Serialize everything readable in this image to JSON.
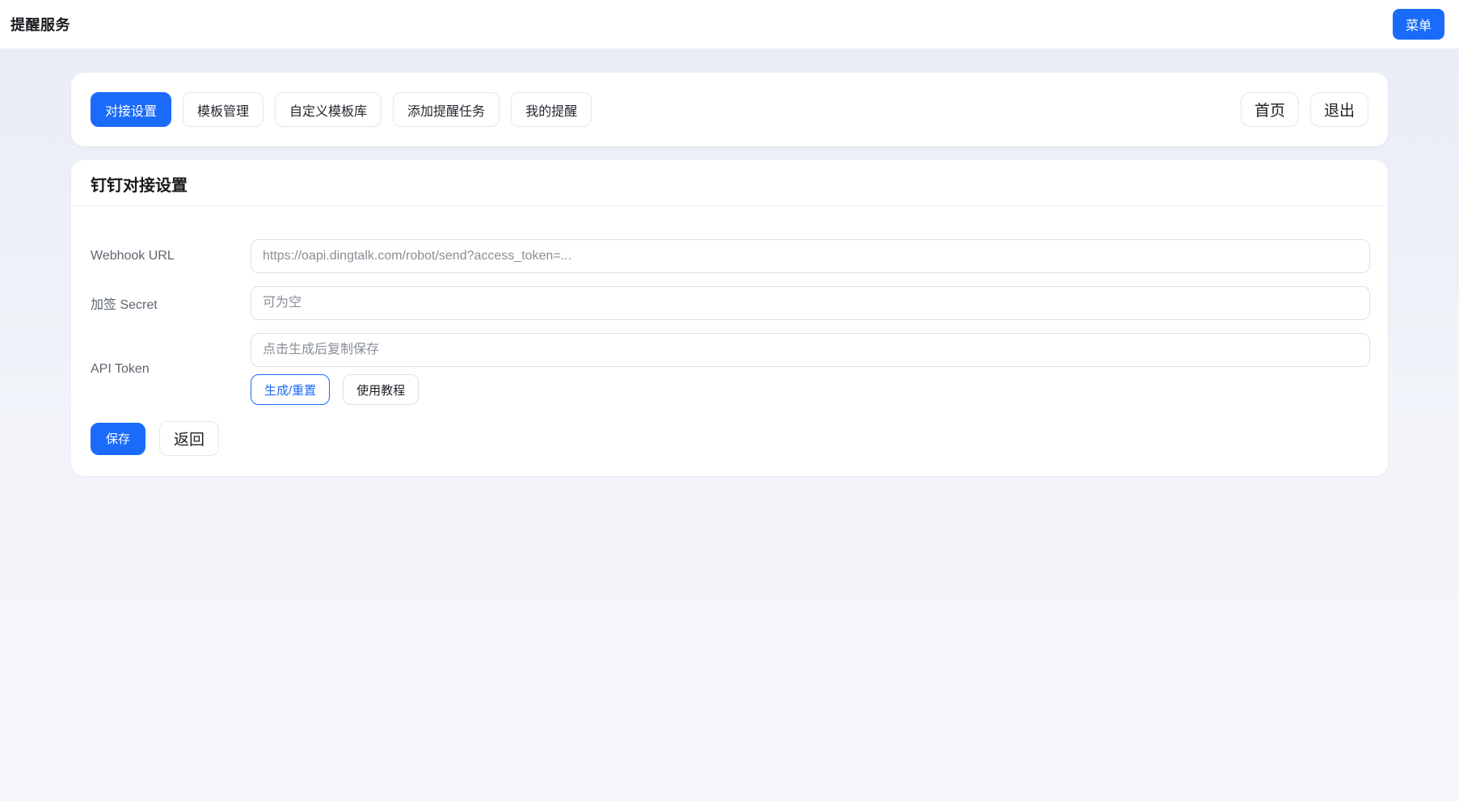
{
  "header": {
    "title": "提醒服务",
    "menu_button": "菜单"
  },
  "nav": {
    "tabs": [
      {
        "label": "对接设置",
        "active": true
      },
      {
        "label": "模板管理",
        "active": false
      },
      {
        "label": "自定义模板库",
        "active": false
      },
      {
        "label": "添加提醒任务",
        "active": false
      },
      {
        "label": "我的提醒",
        "active": false
      }
    ],
    "home_button": "首页",
    "logout_button": "退出"
  },
  "panel": {
    "title": "钉钉对接设置",
    "fields": {
      "webhook": {
        "label": "Webhook URL",
        "value": "",
        "placeholder": "https://oapi.dingtalk.com/robot/send?access_token=..."
      },
      "secret": {
        "label": "加签 Secret",
        "value": "",
        "placeholder": "可为空"
      },
      "token": {
        "label": "API Token",
        "value": "",
        "placeholder": "点击生成后复制保存"
      }
    },
    "generate_button": "生成/重置",
    "tutorial_button": "使用教程",
    "save_button": "保存",
    "back_button": "返回"
  },
  "colors": {
    "primary": "#1a6bfa",
    "page_background": "#eef1f7",
    "card_background": "#ffffff"
  }
}
